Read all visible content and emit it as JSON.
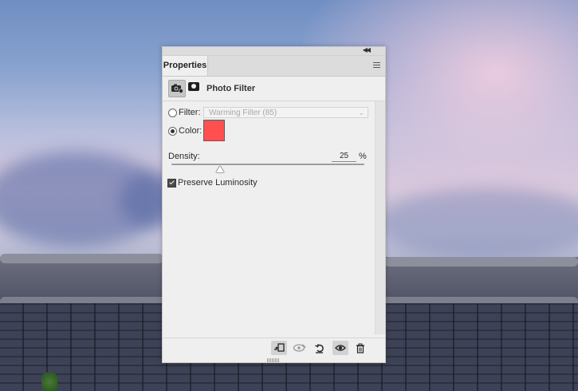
{
  "panel": {
    "tab_label": "Properties",
    "collapse_icon": "double-chevron-left-icon",
    "menu_icon": "hamburger-menu-icon"
  },
  "header": {
    "title": "Photo Filter",
    "adjustment_icon": "camera-adjustment-icon",
    "mask_icon": "layer-mask-icon"
  },
  "filter": {
    "label": "Filter:",
    "selected": false,
    "value": "Warming Filter (85)"
  },
  "color": {
    "label": "Color:",
    "selected": true,
    "swatch": "#ff4f4f"
  },
  "density": {
    "label": "Density:",
    "value": "25",
    "unit": "%",
    "fraction": 0.25
  },
  "preserve_luminosity": {
    "label": "Preserve Luminosity",
    "checked": true
  },
  "footer": {
    "buttons": [
      {
        "icon": "clip-to-layer-icon",
        "active": true
      },
      {
        "icon": "view-previous-state-icon",
        "active": false
      },
      {
        "icon": "reset-to-defaults-icon",
        "active": false
      },
      {
        "icon": "toggle-visibility-eye-icon",
        "active": true
      },
      {
        "icon": "trash-icon",
        "active": false
      }
    ]
  }
}
